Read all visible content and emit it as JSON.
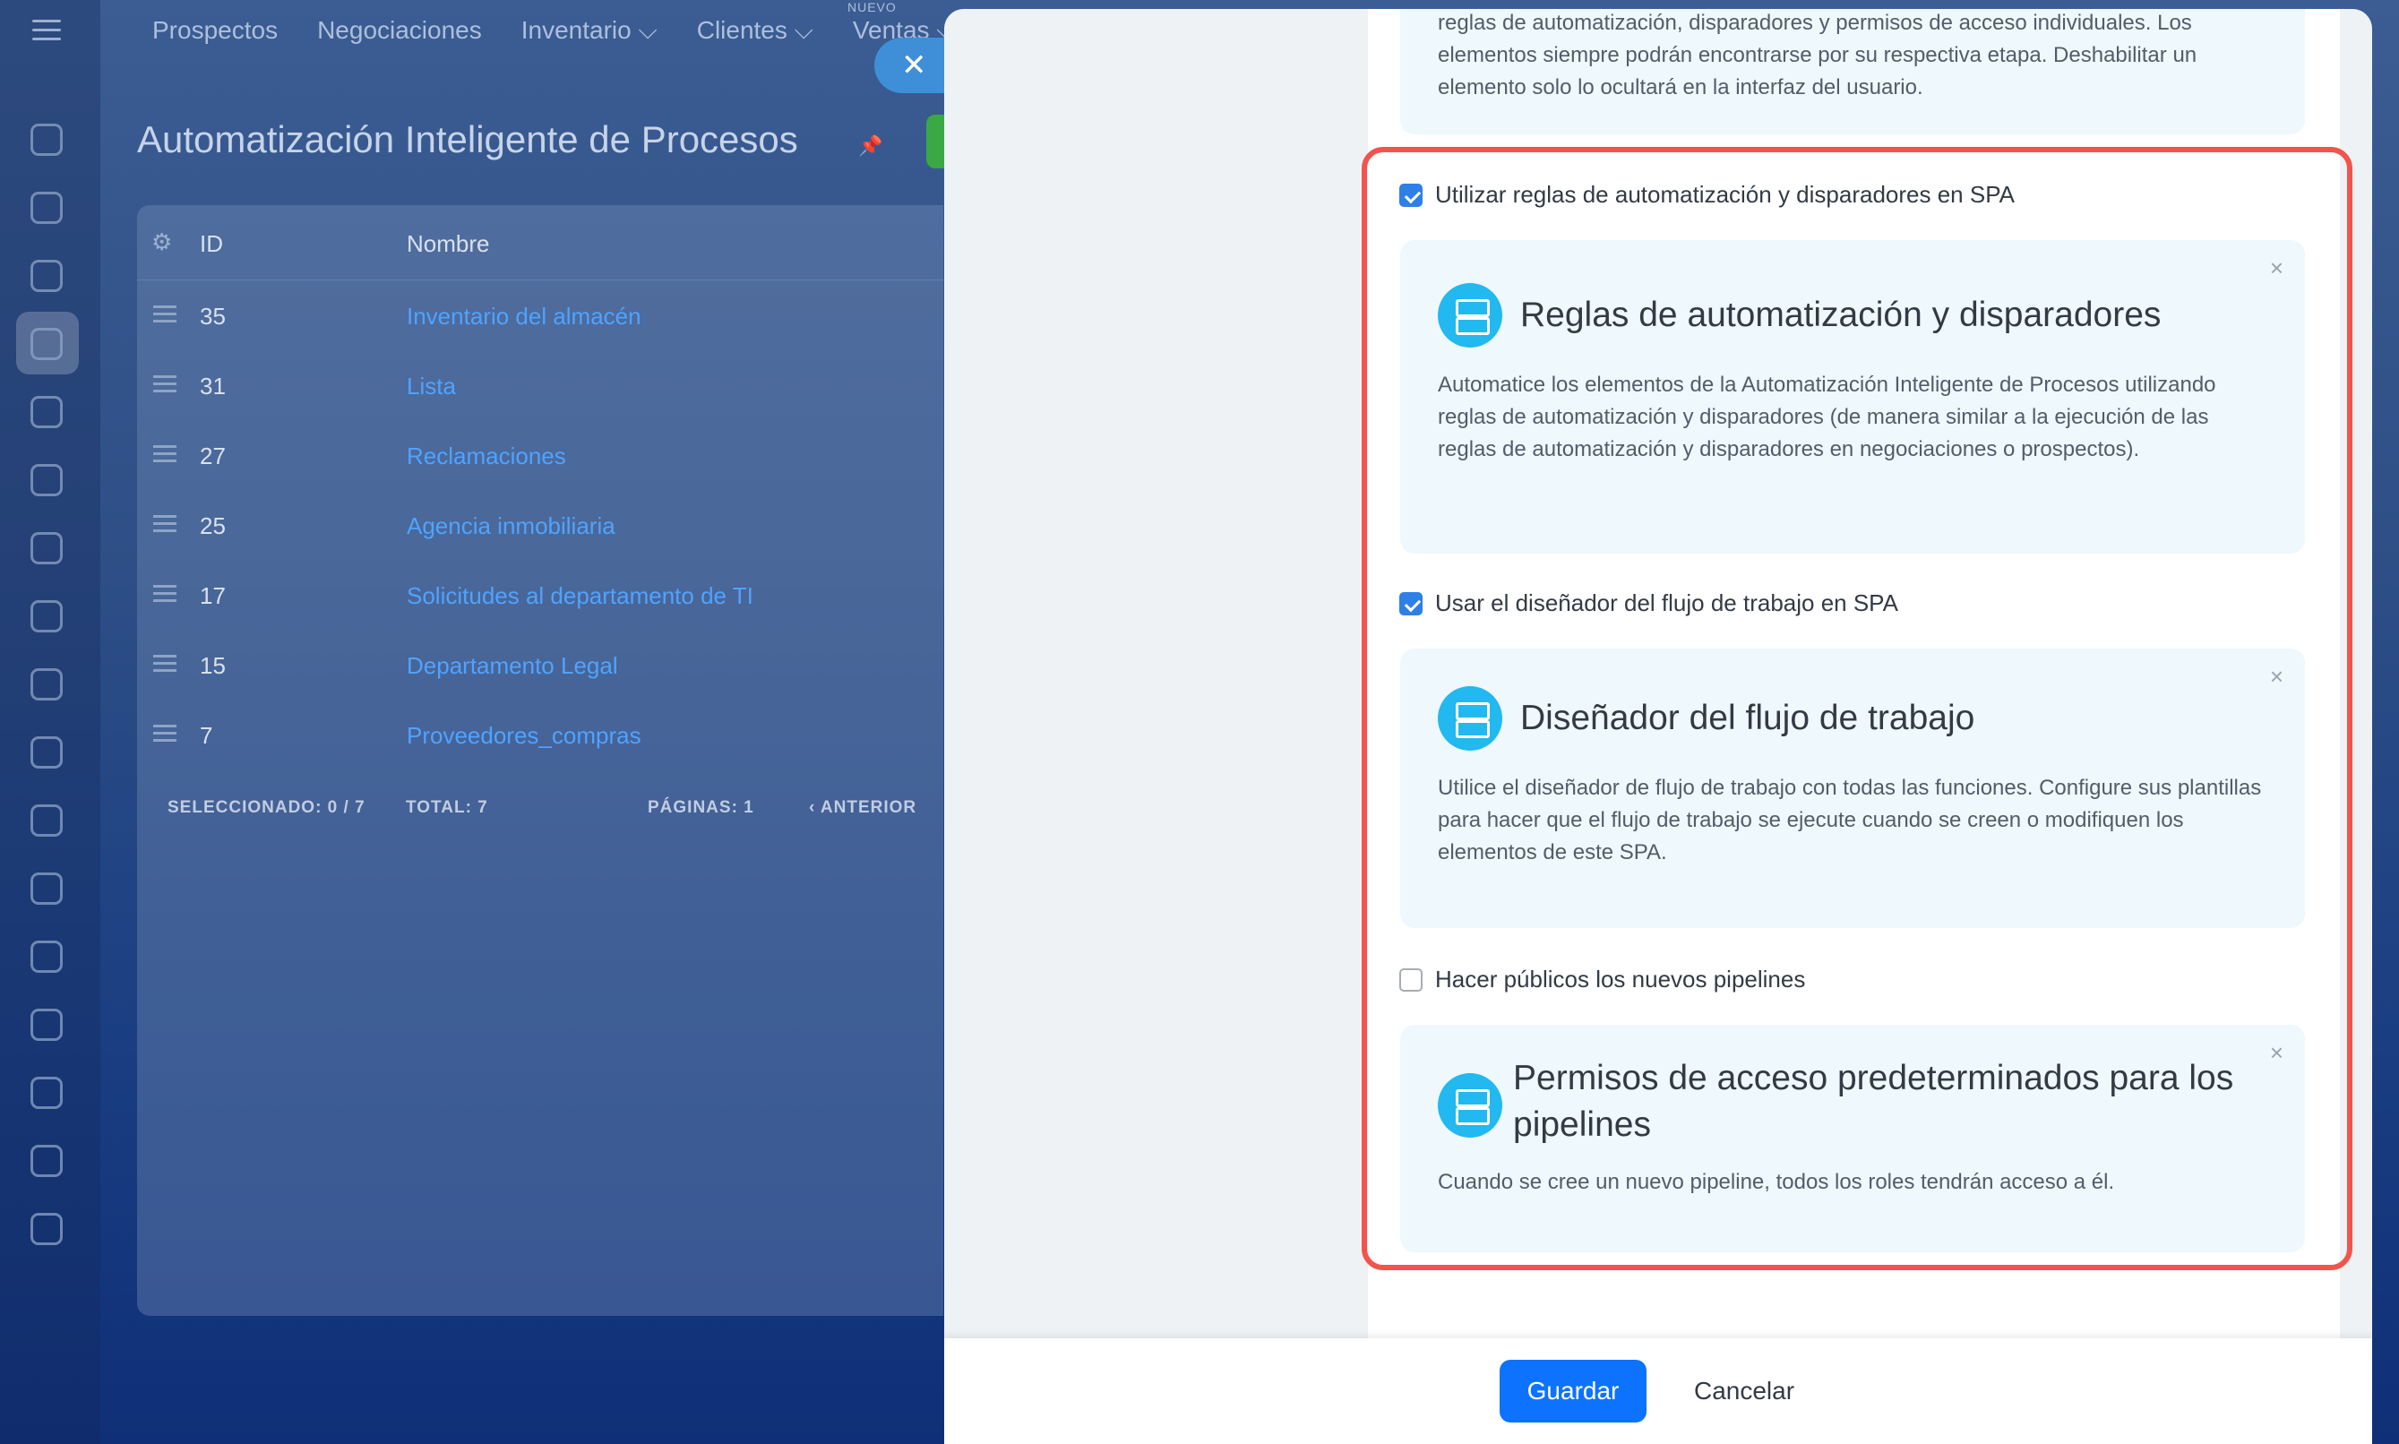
{
  "topnav": {
    "items": [
      "Prospectos",
      "Negociaciones",
      "Inventario ⌵",
      "Clientes ⌵",
      "Ventas ⌵"
    ],
    "nuevo_badge": "NUEVO"
  },
  "page": {
    "title": "Automatización Inteligente de Procesos"
  },
  "grid": {
    "columns": {
      "id": "ID",
      "name": "Nombre"
    },
    "rows": [
      {
        "id": "35",
        "name": "Inventario del almacén"
      },
      {
        "id": "31",
        "name": "Lista"
      },
      {
        "id": "27",
        "name": "Reclamaciones"
      },
      {
        "id": "25",
        "name": "Agencia inmobiliaria"
      },
      {
        "id": "17",
        "name": "Solicitudes al departamento de TI"
      },
      {
        "id": "15",
        "name": "Departamento Legal"
      },
      {
        "id": "7",
        "name": "Proveedores_compras"
      }
    ],
    "footer": {
      "selected": "SELECCIONADO: 0 / 7",
      "total": "TOTAL: 7",
      "pages": "PÁGINAS:  1",
      "prev": "‹ ANTERIOR"
    }
  },
  "panel": {
    "prev_note": "reglas de automatización, disparadores y permisos de acceso individuales. Los elementos siempre podrán encontrarse por su respectiva etapa. Deshabilitar un elemento solo lo ocultará en la interfaz del usuario.",
    "options": [
      {
        "label": "Utilizar reglas de automatización y disparadores en SPA",
        "checked": true,
        "card_title": "Reglas de automatización y disparadores",
        "card_text": "Automatice los elementos de la Automatización Inteligente de Procesos utilizando reglas de automatización y disparadores (de manera similar a la ejecución de las reglas de automatización y disparadores en negociaciones o prospectos)."
      },
      {
        "label": "Usar el diseñador del flujo de trabajo en SPA",
        "checked": true,
        "card_title": "Diseñador del flujo de trabajo",
        "card_text": "Utilice el diseñador de flujo de trabajo con todas las funciones. Configure sus plantillas para hacer que el flujo de trabajo se ejecute cuando se creen o modifiquen los elementos de este SPA."
      },
      {
        "label": "Hacer públicos los nuevos pipelines",
        "checked": false,
        "card_title": "Permisos de acceso predeterminados para los pipelines",
        "card_text": "Cuando se cree un nuevo pipeline, todos los roles tendrán acceso a él."
      }
    ],
    "close_glyph": "✕",
    "dismiss_glyph": "×"
  },
  "footer": {
    "save": "Guardar",
    "cancel": "Cancelar"
  },
  "colors": {
    "accent": "#0d73ff",
    "highlight": "#f0554d",
    "icon": "#22b8f0"
  }
}
